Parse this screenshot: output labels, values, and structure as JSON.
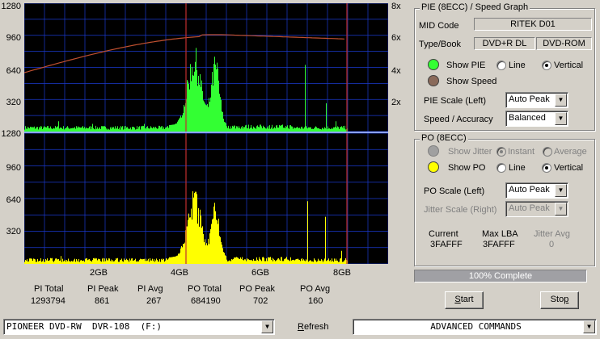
{
  "graph": {
    "top_y_labels": [
      "1280",
      "960",
      "640",
      "320"
    ],
    "top_right_labels": [
      "8x",
      "6x",
      "4x",
      "2x"
    ],
    "bottom_y_labels": [
      "1280",
      "960",
      "640",
      "320"
    ],
    "x_labels": [
      "2GB",
      "4GB",
      "6GB",
      "8GB"
    ]
  },
  "stats": {
    "pi_total_label": "PI Total",
    "pi_total": "1293794",
    "pi_peak_label": "PI Peak",
    "pi_peak": "861",
    "pi_avg_label": "PI Avg",
    "pi_avg": "267",
    "po_total_label": "PO Total",
    "po_total": "684190",
    "po_peak_label": "PO Peak",
    "po_peak": "702",
    "po_avg_label": "PO Avg",
    "po_avg": "160"
  },
  "pie_panel": {
    "title": "PIE (8ECC) / Speed Graph",
    "mid_code_label": "MID Code",
    "mid_code_value": "RITEK    D01",
    "type_book_label": "Type/Book",
    "type_value": "DVD+R DL",
    "book_value": "DVD-ROM",
    "show_pie_label": "Show PIE",
    "line_label": "Line",
    "vertical_label": "Vertical",
    "show_speed_label": "Show Speed",
    "pie_scale_label": "PIE Scale (Left)",
    "pie_scale_value": "Auto Peak",
    "speed_accuracy_label": "Speed / Accuracy",
    "speed_accuracy_value": "Balanced"
  },
  "po_panel": {
    "title": "PO (8ECC)",
    "show_jitter_label": "Show Jitter",
    "instant_label": "Instant",
    "average_label": "Average",
    "show_po_label": "Show PO",
    "line_label": "Line",
    "vertical_label": "Vertical",
    "po_scale_label": "PO Scale (Left)",
    "po_scale_value": "Auto Peak",
    "jitter_scale_label": "Jitter Scale (Right)",
    "jitter_scale_value": "Auto Peak",
    "current_label": "Current",
    "current_value": "3FAFFF",
    "max_lba_label": "Max LBA",
    "max_lba_value": "3FAFFF",
    "jitter_avg_label": "Jitter Avg",
    "jitter_avg_value": "0"
  },
  "progress": {
    "text": "100% Complete",
    "fraction": 1.0
  },
  "buttons": {
    "start_pre": "",
    "start_ul": "S",
    "start_post": "tart",
    "stop_pre": "Sto",
    "stop_ul": "p",
    "stop_post": ""
  },
  "bottom": {
    "drive_value": "PIONEER DVD-RW  DVR-108  (F:)",
    "refresh_ul": "R",
    "refresh_rest": "efresh",
    "commands_value": "ADVANCED COMMANDS"
  },
  "colors": {
    "pie": "#33ff33",
    "po": "#ffff00",
    "speed": "#c05030",
    "grid": "#1a3ad0",
    "marker": "#c03030",
    "graph_bg": "#000000"
  }
}
